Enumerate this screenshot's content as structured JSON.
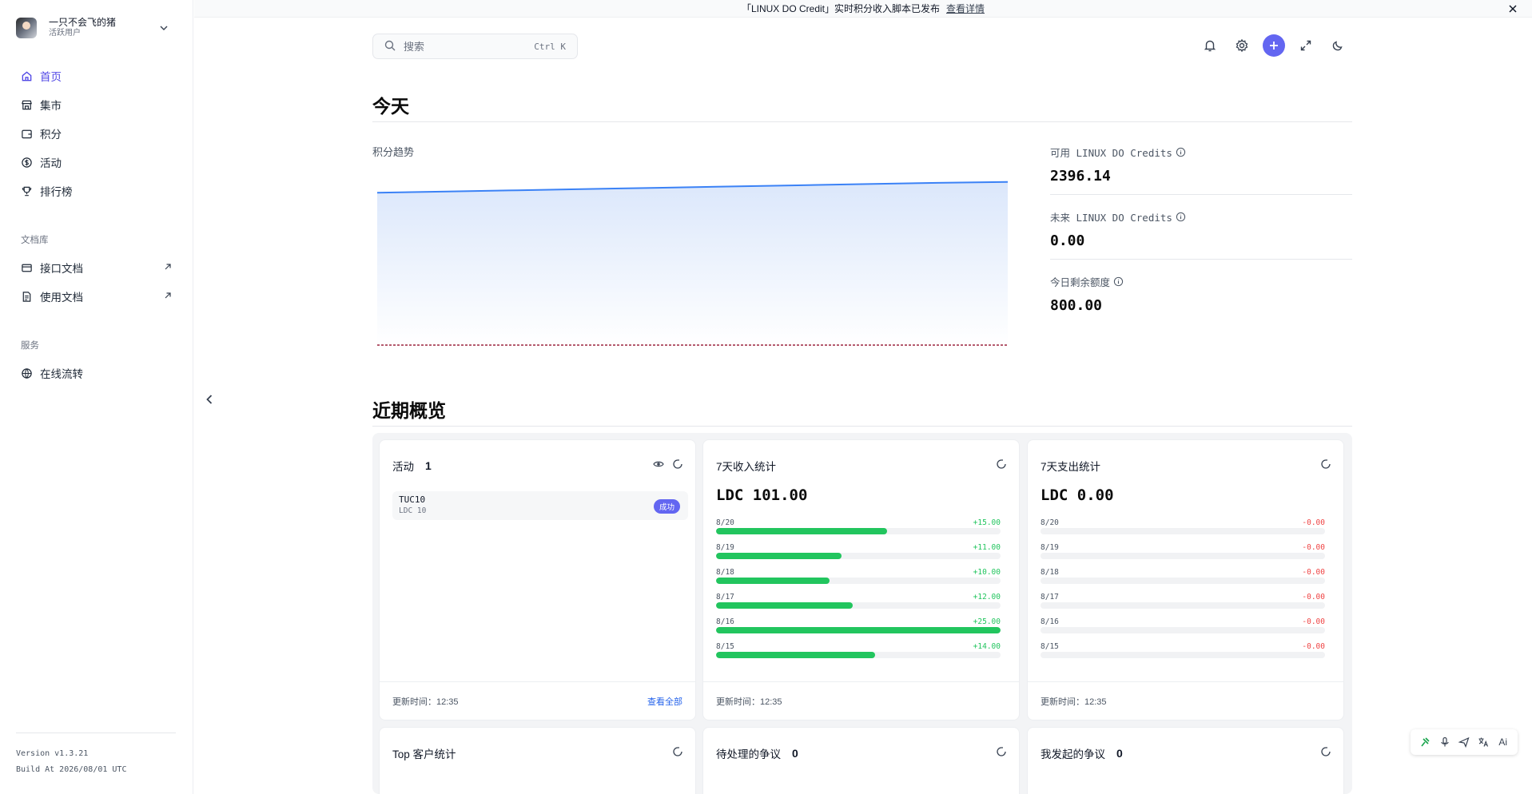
{
  "banner": {
    "text": "「LINUX DO Credit」实时积分收入脚本已发布",
    "link": "查看详情",
    "close_icon": "close-icon"
  },
  "user": {
    "name": "一只不会飞的猪",
    "role": "活跃用户"
  },
  "sidebar": {
    "items": [
      {
        "label": "首页",
        "icon": "home-icon",
        "active": true
      },
      {
        "label": "集市",
        "icon": "store-icon"
      },
      {
        "label": "积分",
        "icon": "wallet-icon"
      },
      {
        "label": "活动",
        "icon": "dollar-icon"
      },
      {
        "label": "排行榜",
        "icon": "trophy-icon"
      }
    ],
    "docs_section": "文档库",
    "docs": [
      {
        "label": "接口文档",
        "icon": "card-icon",
        "external": true
      },
      {
        "label": "使用文档",
        "icon": "file-icon",
        "external": true
      }
    ],
    "services_section": "服务",
    "services": [
      {
        "label": "在线流转",
        "icon": "globe-icon"
      }
    ],
    "version": "Version v1.3.21",
    "build": "Build At 2026/08/01 UTC"
  },
  "search": {
    "placeholder": "搜索",
    "shortcut": "Ctrl K"
  },
  "today": {
    "title": "今天",
    "chart_label": "积分趋势",
    "stats": [
      {
        "label": "可用 LINUX DO Credits",
        "value": "2396.14"
      },
      {
        "label": "未来 LINUX DO Credits",
        "value": "0.00"
      },
      {
        "label": "今日剩余额度",
        "value": "800.00"
      }
    ]
  },
  "chart_data": {
    "type": "area",
    "title": "积分趋势",
    "series": [
      {
        "values": [
          2370,
          2373,
          2376,
          2379,
          2382,
          2385,
          2388,
          2391,
          2394,
          2396.14
        ]
      }
    ],
    "grid": false
  },
  "recent": {
    "title": "近期概览",
    "activity": {
      "title": "活动",
      "count": "1",
      "items": [
        {
          "name": "TUC10",
          "sub": "LDC 10",
          "status": "成功"
        }
      ],
      "updated": "更新时间：12:35",
      "view_all": "查看全部"
    },
    "income": {
      "title": "7天收入统计",
      "total": "LDC 101.00",
      "updated": "更新时间：12:35",
      "rows": [
        {
          "date": "8/20",
          "amount": "+15.00",
          "ratio": 0.6
        },
        {
          "date": "8/19",
          "amount": "+11.00",
          "ratio": 0.44
        },
        {
          "date": "8/18",
          "amount": "+10.00",
          "ratio": 0.4
        },
        {
          "date": "8/17",
          "amount": "+12.00",
          "ratio": 0.48
        },
        {
          "date": "8/16",
          "amount": "+25.00",
          "ratio": 1.0
        },
        {
          "date": "8/15",
          "amount": "+14.00",
          "ratio": 0.56
        }
      ]
    },
    "expense": {
      "title": "7天支出统计",
      "total": "LDC 0.00",
      "updated": "更新时间：12:35",
      "rows": [
        {
          "date": "8/20",
          "amount": "-0.00",
          "ratio": 0
        },
        {
          "date": "8/19",
          "amount": "-0.00",
          "ratio": 0
        },
        {
          "date": "8/18",
          "amount": "-0.00",
          "ratio": 0
        },
        {
          "date": "8/17",
          "amount": "-0.00",
          "ratio": 0
        },
        {
          "date": "8/16",
          "amount": "-0.00",
          "ratio": 0
        },
        {
          "date": "8/15",
          "amount": "-0.00",
          "ratio": 0
        }
      ]
    },
    "top_customers": {
      "title": "Top 客户统计"
    },
    "pending_disputes": {
      "title": "待处理的争议",
      "count": "0"
    },
    "my_disputes": {
      "title": "我发起的争议",
      "count": "0"
    }
  },
  "floating_tool": {
    "ai_label": "Ai"
  },
  "colors": {
    "accent": "#6366f1",
    "income": "#22c55e",
    "expense": "#ef4444",
    "line": "#3b82f6"
  }
}
